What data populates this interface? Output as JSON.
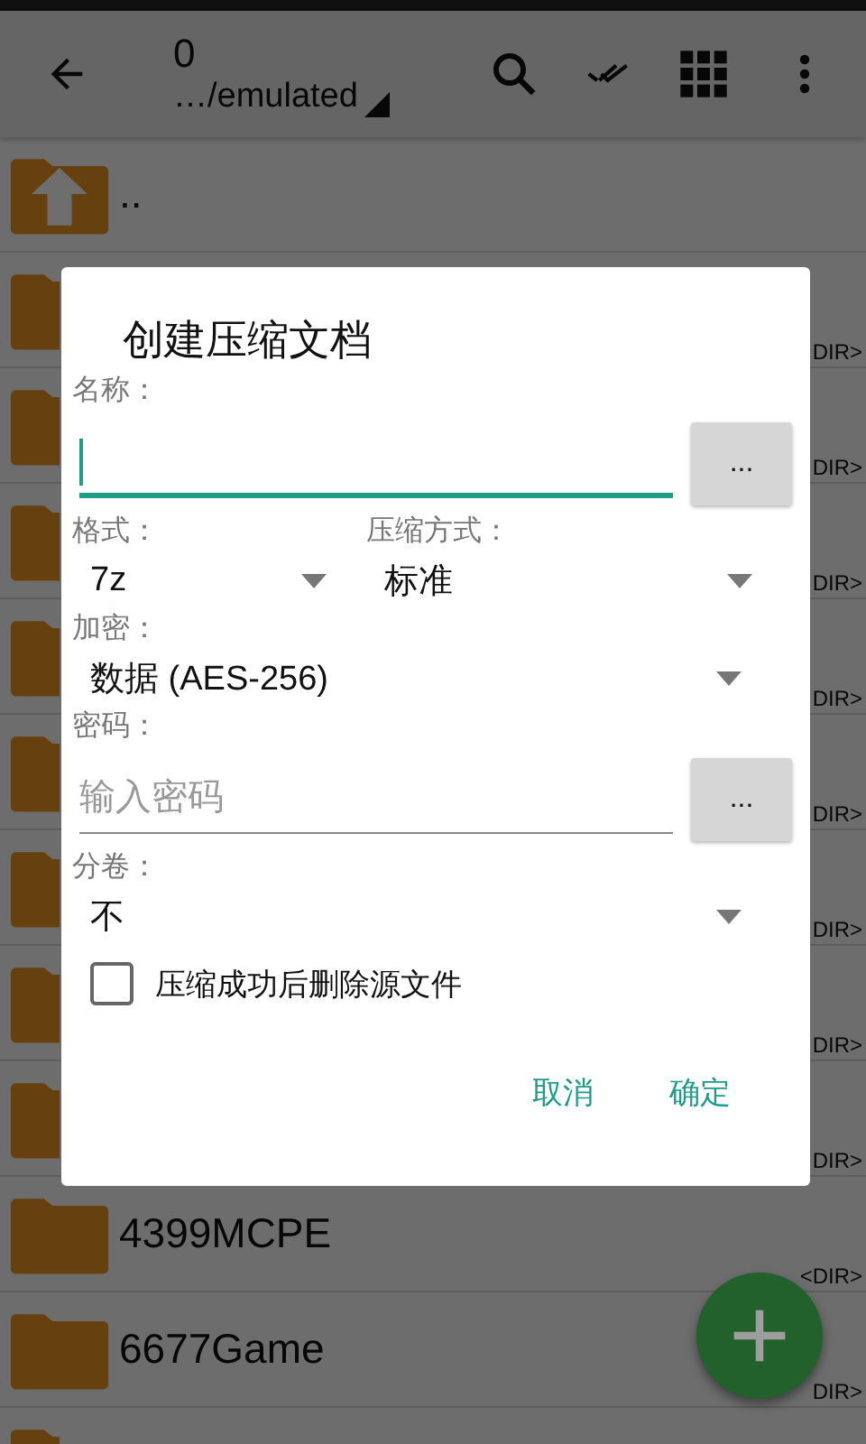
{
  "toolbar": {
    "title": "0",
    "path": "…/emulated"
  },
  "rows": [
    {
      "kind": "up",
      "name": ".."
    },
    {
      "kind": "folder",
      "dir": "DIR>"
    },
    {
      "kind": "folder",
      "dir": "DIR>"
    },
    {
      "kind": "folder",
      "dir": "DIR>"
    },
    {
      "kind": "folder",
      "dir": "DIR>"
    },
    {
      "kind": "folder",
      "dir": "DIR>"
    },
    {
      "kind": "folder",
      "dir": "DIR>"
    },
    {
      "kind": "folder",
      "dir": "DIR>"
    },
    {
      "kind": "folder",
      "dir": "DIR>"
    },
    {
      "kind": "folder",
      "name": "4399MCPE",
      "dir": "<DIR>"
    },
    {
      "kind": "folder",
      "name": "6677Game",
      "dir": "DIR>"
    },
    {
      "kind": "folder"
    }
  ],
  "dialog": {
    "title": "创建压缩文档",
    "name_field": {
      "label": "名称：",
      "focused": true,
      "browse": "..."
    },
    "format": {
      "label": "格式：",
      "value": "7z"
    },
    "method": {
      "label": "压缩方式：",
      "value": "标准"
    },
    "encryption": {
      "label": "加密：",
      "value": "数据 (AES-256)"
    },
    "password": {
      "label": "密码：",
      "placeholder": "输入密码",
      "browse": "..."
    },
    "volumes": {
      "label": "分卷：",
      "value": "不"
    },
    "delete_source": {
      "label": "压缩成功后删除源文件",
      "checked": false
    },
    "buttons": [
      "取消",
      "确定"
    ]
  }
}
